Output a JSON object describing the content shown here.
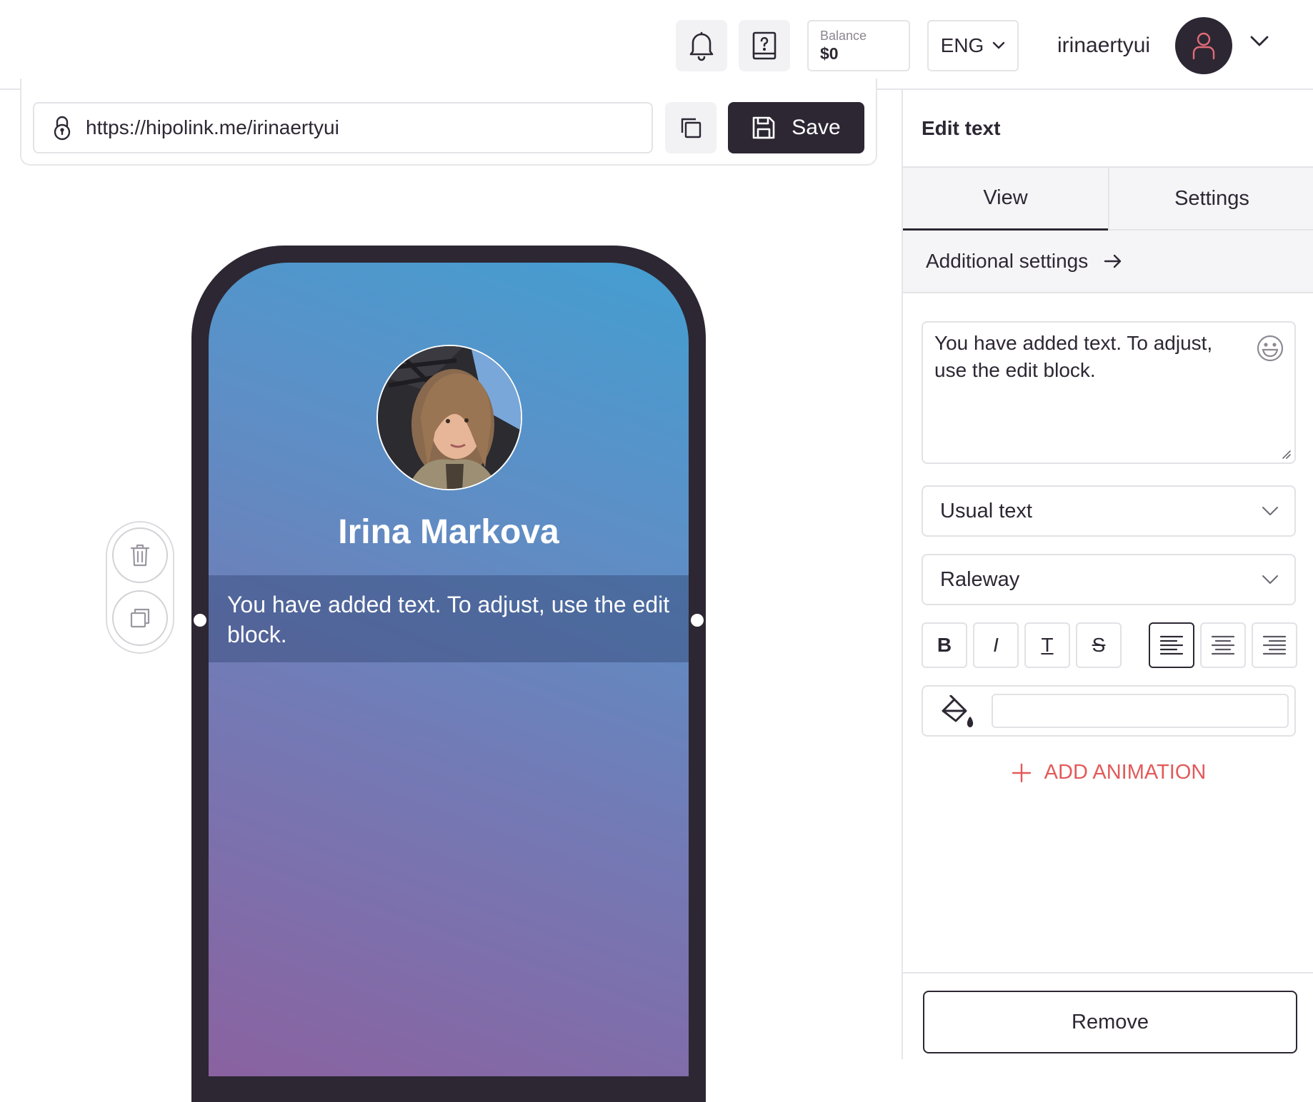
{
  "header": {
    "balance_label": "Balance",
    "balance_value": "$0",
    "language": "ENG",
    "username": "irinaertyui"
  },
  "editor": {
    "url": "https://hipolink.me/irinaertyui",
    "save_label": "Save"
  },
  "preview": {
    "profile_name": "Irina Markova",
    "text_block": "You have added text. To adjust, use the edit block."
  },
  "panel": {
    "title": "Edit text",
    "tabs": [
      {
        "label": "View",
        "active": true
      },
      {
        "label": "Settings",
        "active": false
      }
    ],
    "additional_settings": "Additional settings",
    "text_value": "You have added text. To adjust, use the edit block.",
    "text_style": "Usual text",
    "font": "Raleway",
    "format_buttons": [
      "B",
      "I",
      "T",
      "S"
    ],
    "add_animation": "ADD ANIMATION",
    "remove_label": "Remove"
  },
  "colors": {
    "dark": "#2d2733",
    "accent_red": "#e35a5a",
    "gradient_top": "#449ed1",
    "gradient_bottom": "#8a62a0"
  }
}
